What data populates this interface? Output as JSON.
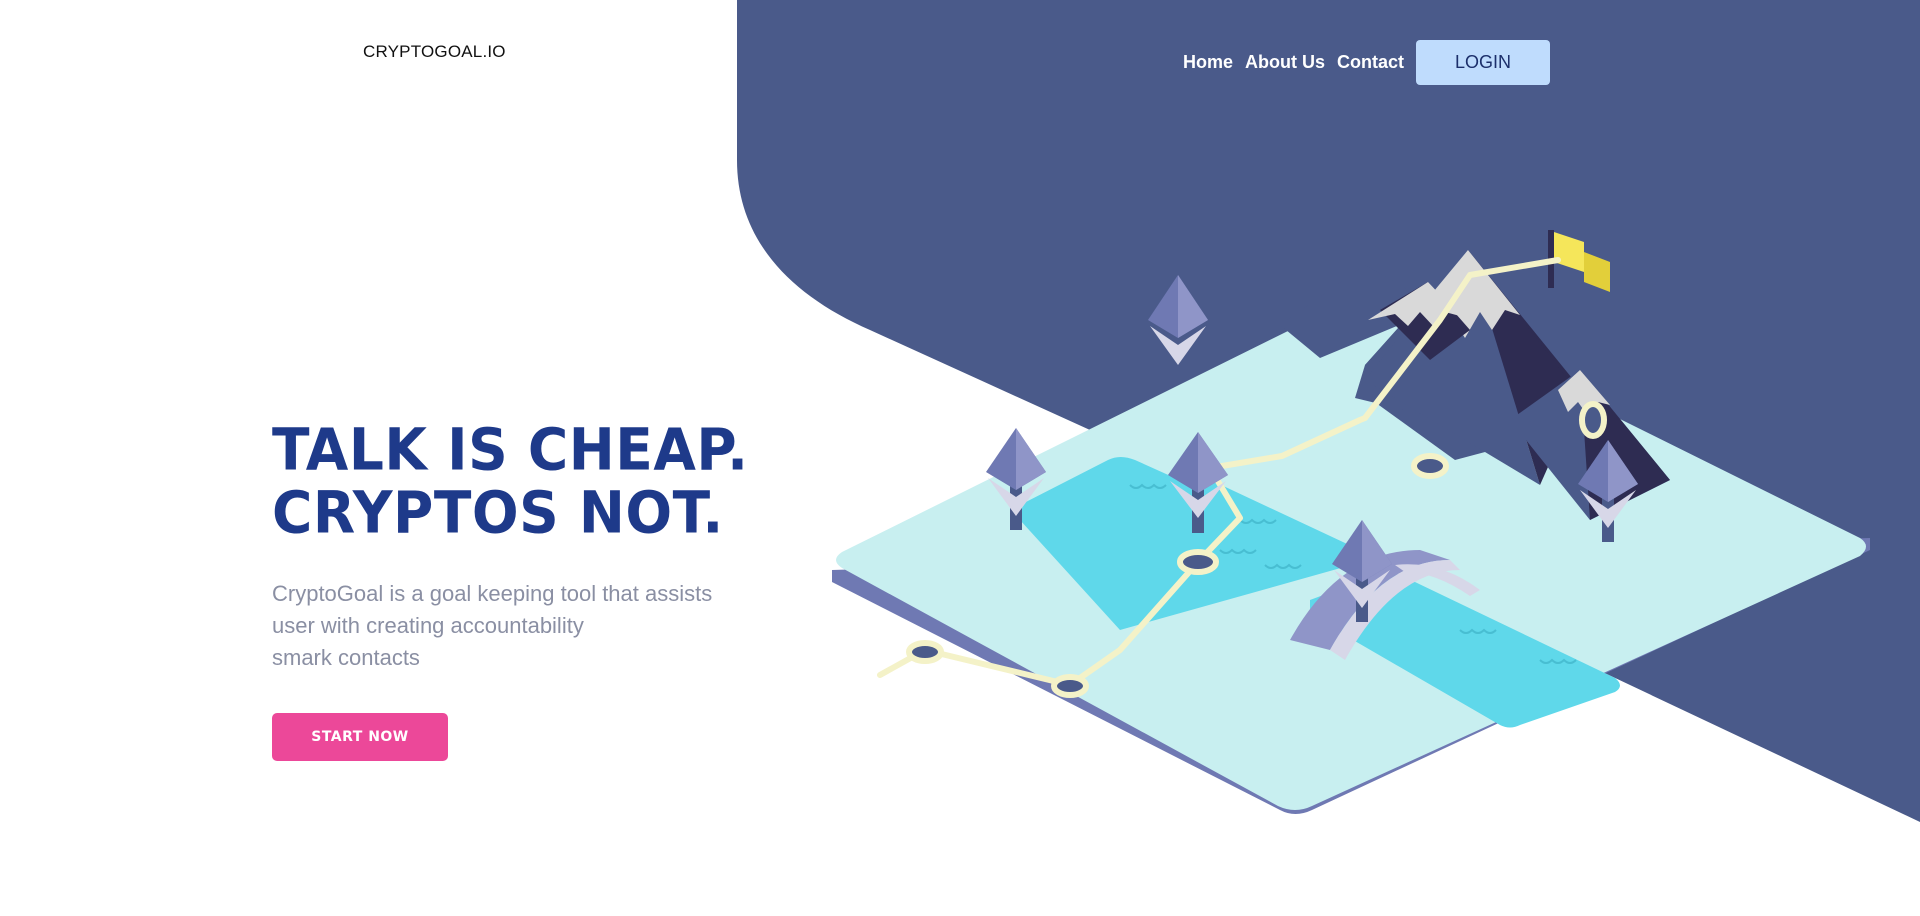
{
  "brand": {
    "logo_text": "CRYPTOGOAL.IO"
  },
  "nav": {
    "items": [
      {
        "label": "Home"
      },
      {
        "label": "About Us"
      },
      {
        "label": "Contact"
      }
    ],
    "login_label": "LOGIN"
  },
  "hero": {
    "title_line1": "TALK IS CHEAP.",
    "title_line2": "CRYPTOS NOT.",
    "description_lines": [
      "CryptoGoal is a goal keeping tool that assists",
      "user with creating accountability",
      "smark contacts"
    ],
    "cta_label": "START NOW"
  },
  "colors": {
    "panel": "#4a5a8a",
    "title": "#1e3a8a",
    "cta": "#ec4899",
    "login_bg": "#bfdcfd",
    "description": "#8a8fa3",
    "platform": "#c8eff0",
    "water": "#5fd8ea",
    "platform_edge": "#6f79b3",
    "mountain_dark": "#2e2c52",
    "flag": "#f5e65a"
  },
  "illustration": {
    "icons": [
      "mountain-icon",
      "flag-icon",
      "ethereum-tree-icon",
      "bridge-icon",
      "path-node-icon",
      "water-icon"
    ]
  }
}
